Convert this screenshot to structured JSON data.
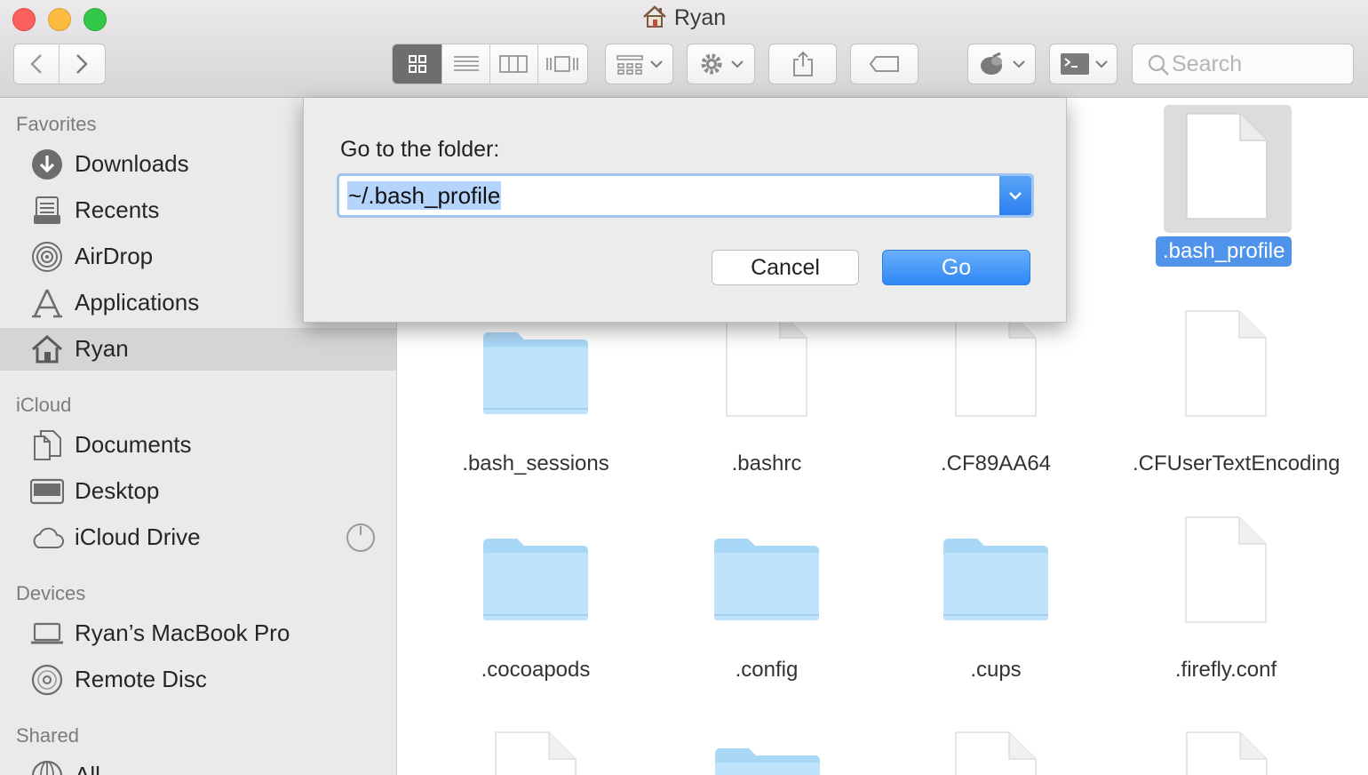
{
  "window": {
    "title": "Ryan"
  },
  "toolbar": {
    "search_placeholder": "Search"
  },
  "sidebar": {
    "sections": {
      "favorites": "Favorites",
      "icloud": "iCloud",
      "devices": "Devices",
      "shared": "Shared"
    },
    "favorites": [
      {
        "label": "Downloads",
        "icon": "downloads-icon"
      },
      {
        "label": "Recents",
        "icon": "recents-icon"
      },
      {
        "label": "AirDrop",
        "icon": "airdrop-icon"
      },
      {
        "label": "Applications",
        "icon": "applications-icon"
      },
      {
        "label": "Ryan",
        "icon": "home-icon",
        "selected": true
      }
    ],
    "icloud": [
      {
        "label": "Documents",
        "icon": "documents-icon"
      },
      {
        "label": "Desktop",
        "icon": "desktop-icon"
      },
      {
        "label": "iCloud Drive",
        "icon": "cloud-icon"
      }
    ],
    "devices": [
      {
        "label": "Ryan’s MacBook Pro",
        "icon": "laptop-icon"
      },
      {
        "label": "Remote Disc",
        "icon": "disc-icon"
      }
    ],
    "shared": [
      {
        "label": "All…",
        "icon": "network-icon"
      }
    ]
  },
  "files": {
    "selected": ".bash_profile",
    "items": [
      {
        "name": ".bash_sessions",
        "kind": "folder"
      },
      {
        "name": ".bashrc",
        "kind": "file"
      },
      {
        "name": ".CF89AA64",
        "kind": "file"
      },
      {
        "name": ".CFUserTextEncoding",
        "kind": "file"
      },
      {
        "name": ".cocoapods",
        "kind": "folder"
      },
      {
        "name": ".config",
        "kind": "folder"
      },
      {
        "name": ".cups",
        "kind": "folder"
      },
      {
        "name": ".firefly.conf",
        "kind": "file"
      }
    ]
  },
  "dialog": {
    "prompt": "Go to the folder:",
    "path_value": "~/.bash_profile",
    "cancel_label": "Cancel",
    "go_label": "Go"
  },
  "colors": {
    "accent": "#2f86f6",
    "selection": "#4f94ea",
    "folder": "#bfe3fb"
  }
}
